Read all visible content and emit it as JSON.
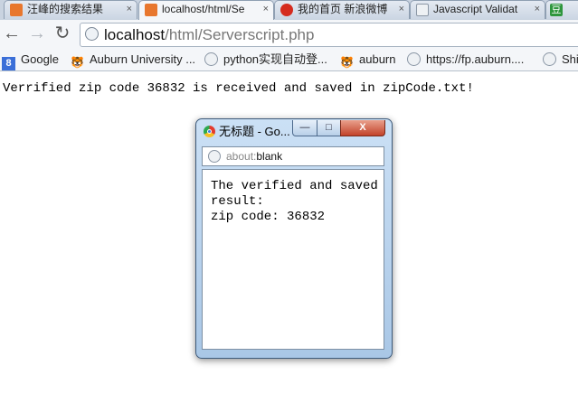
{
  "browser": {
    "tabs": [
      {
        "label": "汪峰的搜索结果",
        "favicon": "search-favicon",
        "color": "#e8772e"
      },
      {
        "label": "localhost/html/Se",
        "favicon": "xampp-favicon",
        "color": "#e8772e",
        "active": true
      },
      {
        "label": "我的首页 新浪微博",
        "favicon": "weibo-favicon",
        "color": "#d52b1e"
      },
      {
        "label": "Javascript Validat",
        "favicon": "globe-favicon",
        "color": "#9aa4b0"
      },
      {
        "label": "豆",
        "favicon": "douban-favicon",
        "color": "#2e963d"
      }
    ],
    "close_glyph": "×",
    "url": {
      "host": "localhost",
      "path": "/html/Serverscript.php"
    },
    "nav": {
      "back": "←",
      "forward": "→",
      "reload": "↻"
    },
    "bookmarks": [
      {
        "label": "Google",
        "icon": "google-icon",
        "glyph": "8"
      },
      {
        "label": "Auburn University ...",
        "icon": "auburn-tiger-icon",
        "glyph": "🐯"
      },
      {
        "label": "python实现自动登...",
        "icon": "globe-icon",
        "glyph": ""
      },
      {
        "label": "auburn",
        "icon": "auburn-tiger-icon",
        "glyph": "🐯"
      },
      {
        "label": "https://fp.auburn....",
        "icon": "globe-icon",
        "glyph": ""
      },
      {
        "label": "Shi",
        "icon": "globe-icon",
        "glyph": ""
      }
    ]
  },
  "page": {
    "message": "Verrified zip code 36832 is received and saved in zipCode.txt!"
  },
  "popup": {
    "title": "无标题 - Go...",
    "url_prefix": "about:",
    "url_main": "blank",
    "content_line1": "The verified and saved",
    "content_line2": "result:",
    "content_line3": "zip code: 36832",
    "buttons": {
      "minimize": "—",
      "maximize": "□",
      "close": "X"
    }
  }
}
